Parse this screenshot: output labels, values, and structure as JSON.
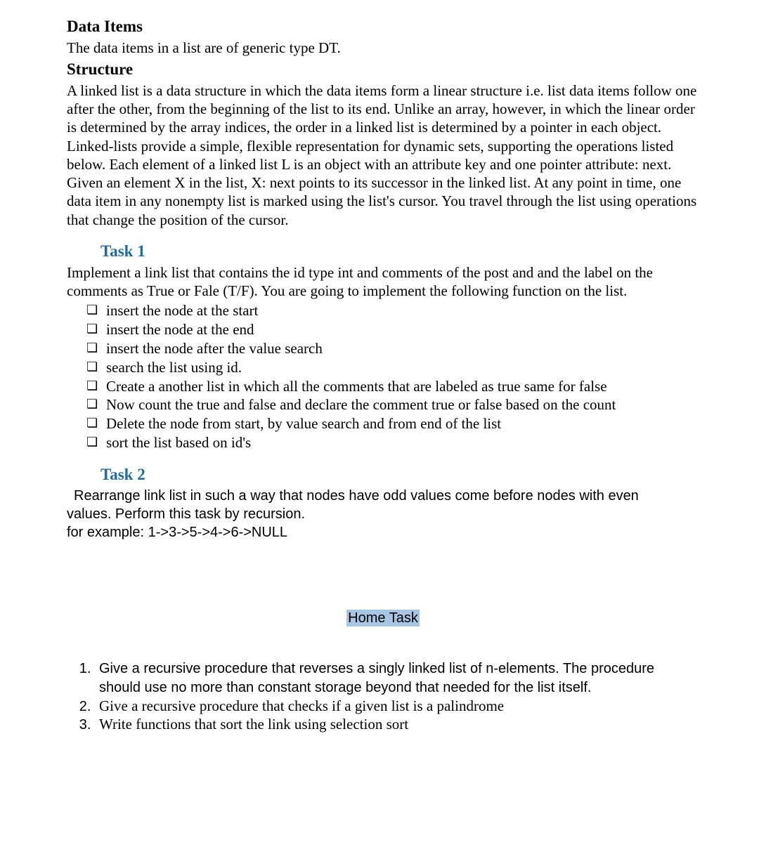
{
  "headings": {
    "data_items": "Data Items",
    "structure": "Structure",
    "task1": "Task 1",
    "task2": "Task 2",
    "home_task": "Home Task"
  },
  "paras": {
    "data_items": "The data items in a list are of generic type DT.",
    "structure": "A linked list is a data structure in which the data items form a linear structure i.e. list data items follow one after the other, from the beginning of the list to its end. Unlike an array, however, in which the linear order is determined by the array indices, the order in a linked list is determined by a pointer in each object. Linked-lists provide a simple, flexible representation for dynamic sets, supporting the operations listed below. Each element of a linked list L is an object with an attribute key and one pointer attribute: next. Given an element X in the list, X: next points to its successor in the linked list. At any point in time, one data item in any nonempty list is marked using the list's cursor. You travel through the list using operations that change the position of the cursor.",
    "task1": "Implement a link list that contains the id type int and comments of the post and and the label on the comments as True or Fale (T/F). You are going to implement the following function on the list.",
    "task2_line1": "Rearrange link list in such a way that nodes have odd values come before nodes with even",
    "task2_line2": "values. Perform this task by recursion.",
    "task2_line3": "for example: 1->3->5->4->6->NULL"
  },
  "task1_items": [
    "insert the node at the start",
    "insert the node at the end",
    "insert the node after the value search",
    "search the list using id.",
    "Create a another list in which all the comments that are labeled as true same for false",
    "Now count the true and false and declare the comment true or false based on the count",
    "Delete the node from start, by value search and from end  of the list",
    "sort the list based on id's"
  ],
  "home_items": [
    "Give a recursive procedure that reverses a singly linked list of n-elements. The procedure should use no more than constant storage beyond that needed for the list itself.",
    "Give a recursive procedure that checks if a given list is a palindrome",
    "Write functions that sort the link using selection sort"
  ]
}
